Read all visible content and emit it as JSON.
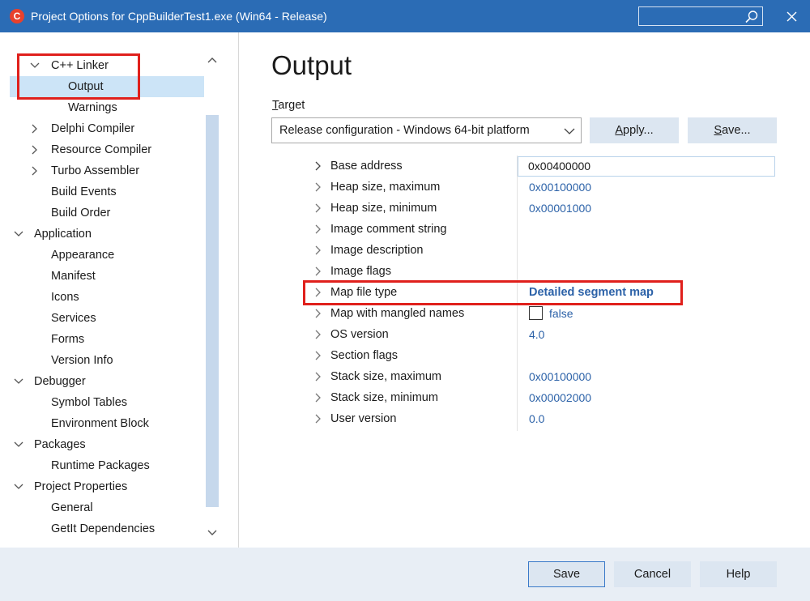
{
  "window": {
    "title": "Project Options for CppBuilderTest1.exe  (Win64 - Release)",
    "app_icon": "C",
    "search_placeholder": "",
    "accent_color": "#2b6cb5"
  },
  "tree": {
    "items": [
      {
        "label": "C++ Linker",
        "level": 1,
        "state": "expanded"
      },
      {
        "label": "Output",
        "level": 2,
        "state": "leaf",
        "selected": true
      },
      {
        "label": "Warnings",
        "level": 2,
        "state": "leaf"
      },
      {
        "label": "Delphi Compiler",
        "level": 1,
        "state": "collapsed"
      },
      {
        "label": "Resource Compiler",
        "level": 1,
        "state": "collapsed"
      },
      {
        "label": "Turbo Assembler",
        "level": 1,
        "state": "collapsed"
      },
      {
        "label": "Build Events",
        "level": 1,
        "state": "leaf"
      },
      {
        "label": "Build Order",
        "level": 1,
        "state": "leaf"
      },
      {
        "label": "Application",
        "level": 0,
        "state": "expanded"
      },
      {
        "label": "Appearance",
        "level": 1,
        "state": "leaf"
      },
      {
        "label": "Manifest",
        "level": 1,
        "state": "leaf"
      },
      {
        "label": "Icons",
        "level": 1,
        "state": "leaf"
      },
      {
        "label": "Services",
        "level": 1,
        "state": "leaf"
      },
      {
        "label": "Forms",
        "level": 1,
        "state": "leaf"
      },
      {
        "label": "Version Info",
        "level": 1,
        "state": "leaf"
      },
      {
        "label": "Debugger",
        "level": 0,
        "state": "expanded"
      },
      {
        "label": "Symbol Tables",
        "level": 1,
        "state": "leaf"
      },
      {
        "label": "Environment Block",
        "level": 1,
        "state": "leaf"
      },
      {
        "label": "Packages",
        "level": 0,
        "state": "expanded"
      },
      {
        "label": "Runtime Packages",
        "level": 1,
        "state": "leaf"
      },
      {
        "label": "Project Properties",
        "level": 0,
        "state": "expanded"
      },
      {
        "label": "General",
        "level": 1,
        "state": "leaf"
      },
      {
        "label": "GetIt Dependencies",
        "level": 1,
        "state": "leaf"
      }
    ]
  },
  "main": {
    "title": "Output",
    "target_label": "Target",
    "target_value": "Release configuration - Windows 64-bit platform",
    "apply_label": "Apply...",
    "save_label": "Save..."
  },
  "properties": [
    {
      "name": "Base address",
      "value": "0x00400000",
      "editing": true
    },
    {
      "name": "Heap size, maximum",
      "value": "0x00100000"
    },
    {
      "name": "Heap size, minimum",
      "value": "0x00001000"
    },
    {
      "name": "Image comment string",
      "value": ""
    },
    {
      "name": "Image description",
      "value": ""
    },
    {
      "name": "Image flags",
      "value": ""
    },
    {
      "name": "Map file type",
      "value": "Detailed segment map",
      "bold": true
    },
    {
      "name": "Map with mangled names",
      "value": "false",
      "checkbox": true,
      "checked": false
    },
    {
      "name": "OS version",
      "value": "4.0"
    },
    {
      "name": "Section flags",
      "value": ""
    },
    {
      "name": "Stack size, maximum",
      "value": "0x00100000"
    },
    {
      "name": "Stack size, minimum",
      "value": "0x00002000"
    },
    {
      "name": "User version",
      "value": "0.0"
    }
  ],
  "footer": {
    "save_label": "Save",
    "cancel_label": "Cancel",
    "help_label": "Help"
  },
  "colors": {
    "highlight": "#e0201c",
    "value_text": "#2c62a8",
    "selection": "#cce4f7"
  }
}
